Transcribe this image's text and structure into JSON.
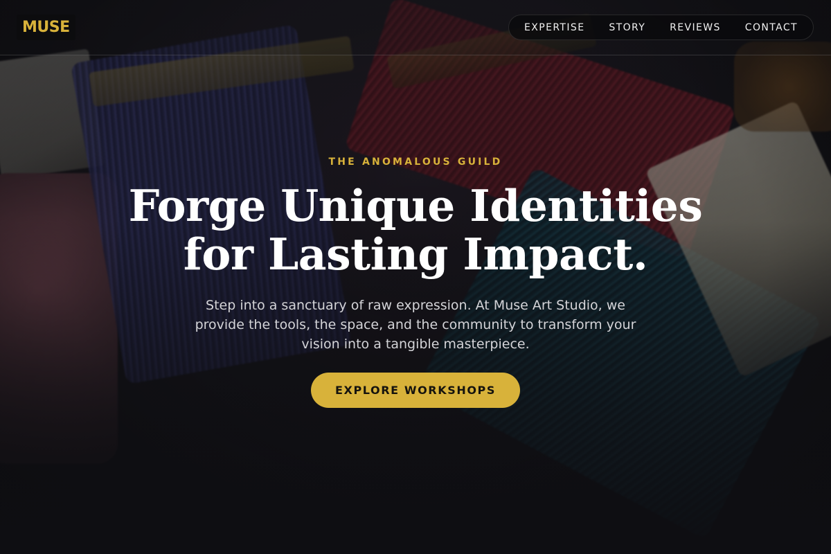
{
  "brand": {
    "logo": "MUSE"
  },
  "nav": {
    "items": [
      {
        "label": "EXPERTISE"
      },
      {
        "label": "STORY"
      },
      {
        "label": "REVIEWS"
      },
      {
        "label": "CONTACT"
      }
    ]
  },
  "hero": {
    "kicker": "THE ANOMALOUS GUILD",
    "headline_line1": "Forge Unique Identities",
    "headline_line2": "for Lasting Impact.",
    "subtext": "Step into a sanctuary of raw expression. At Muse Art Studio, we provide the tools, the space, and the community to transform your vision into a tangible masterpiece.",
    "cta_label": "EXPLORE WORKSHOPS"
  },
  "colors": {
    "accent": "#d8b23a",
    "background": "#0f0f12",
    "text": "#ffffff"
  },
  "background_image": "paint-brushes-photo"
}
